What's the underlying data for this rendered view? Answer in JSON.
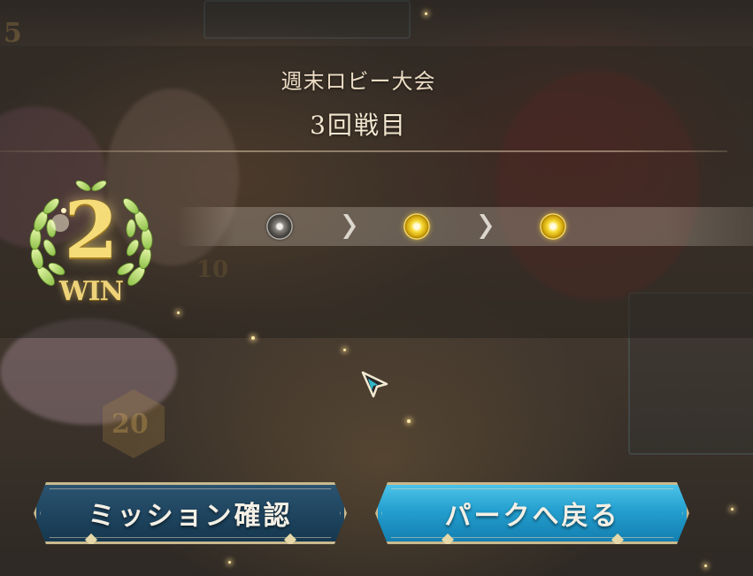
{
  "event": {
    "title": "週末ロビー大会",
    "round": "3回戦目"
  },
  "win_badge": {
    "count": "2",
    "label": "WIN"
  },
  "progress": {
    "medals": [
      {
        "state": "gray"
      },
      {
        "state": "gold"
      },
      {
        "state": "gold"
      }
    ]
  },
  "buttons": {
    "mission": "ミッション確認",
    "back": "パークへ戻る"
  },
  "colors": {
    "gold": "#f6dc78",
    "mission_button": "#1f4560",
    "back_button": "#249fcf"
  }
}
